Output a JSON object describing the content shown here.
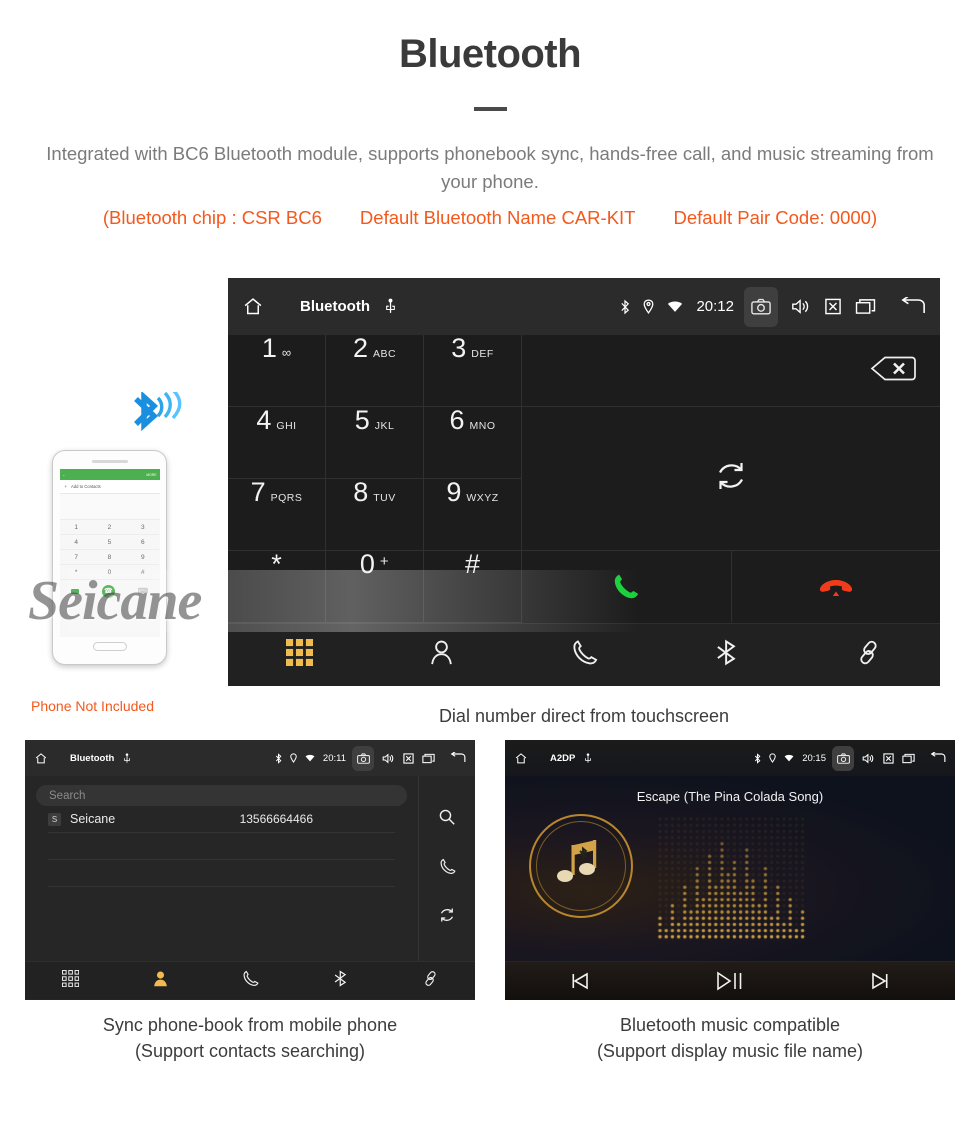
{
  "header": {
    "title": "Bluetooth",
    "description": "Integrated with BC6 Bluetooth module, supports phonebook sync, hands-free call, and music streaming from your phone.",
    "specs": [
      "(Bluetooth chip : CSR BC6",
      "Default Bluetooth Name CAR-KIT",
      "Default Pair Code: 0000)"
    ],
    "accent_color": "#f4581c",
    "text_color": "#7b7b7b"
  },
  "dialer": {
    "statusbar": {
      "title": "Bluetooth",
      "time": "20:12",
      "icons_left": [
        "home-icon",
        "usb-icon"
      ],
      "icons_right": [
        "bluetooth-icon",
        "location-icon",
        "wifi-icon",
        "camera-icon",
        "volume-icon",
        "close-icon",
        "recents-icon",
        "back-icon"
      ]
    },
    "keys": [
      {
        "num": "1",
        "sub": "∞",
        "sub_big": true
      },
      {
        "num": "2",
        "sub": "ABC",
        "sub_big": false
      },
      {
        "num": "3",
        "sub": "DEF",
        "sub_big": false
      },
      {
        "num": "4",
        "sub": "GHI",
        "sub_big": false
      },
      {
        "num": "5",
        "sub": "JKL",
        "sub_big": false
      },
      {
        "num": "6",
        "sub": "MNO",
        "sub_big": false
      },
      {
        "num": "7",
        "sub": "PQRS",
        "sub_big": false
      },
      {
        "num": "8",
        "sub": "TUV",
        "sub_big": false
      },
      {
        "num": "9",
        "sub": "WXYZ",
        "sub_big": false
      },
      {
        "num": "*",
        "sub": "",
        "sub_big": false
      },
      {
        "num": "0",
        "sub": "+",
        "sub_big": true
      },
      {
        "num": "#",
        "sub": "",
        "sub_big": false
      }
    ],
    "actions": {
      "backspace": "backspace-icon",
      "sync": "sync-icon",
      "call": "call-icon",
      "hangup": "hangup-icon"
    },
    "navbar": [
      {
        "name": "keypad",
        "icon": "keypad-icon",
        "active": true
      },
      {
        "name": "contacts",
        "icon": "contacts-icon",
        "active": false
      },
      {
        "name": "call-log",
        "icon": "phone-icon",
        "active": false
      },
      {
        "name": "bluetooth",
        "icon": "bluetooth-icon",
        "active": false
      },
      {
        "name": "pair",
        "icon": "link-icon",
        "active": false
      }
    ],
    "active_color": "#f0bc50",
    "call_color": "#17d13b",
    "hangup_color": "#f23b1a",
    "caption": "Dial number direct from touchscreen"
  },
  "phone_mock": {
    "app_bar_more": "MORE",
    "add_to_contacts": "Add to Contacts",
    "keys": [
      "1",
      "2",
      "3",
      "4",
      "5",
      "6",
      "7",
      "8",
      "9",
      "*",
      "0",
      "#"
    ],
    "label": "Phone Not Included",
    "bluetooth_icon": "bluetooth-broadcast-icon",
    "brand_watermark": "Seicane"
  },
  "phonebook": {
    "statusbar": {
      "title": "Bluetooth",
      "time": "20:11"
    },
    "search_placeholder": "Search",
    "contacts": [
      {
        "initial": "S",
        "name": "Seicane",
        "number": "13566664466"
      }
    ],
    "side_actions": [
      "search-icon",
      "phone-icon",
      "sync-icon"
    ],
    "navbar": [
      {
        "name": "keypad",
        "icon": "keypad-icon",
        "active": false
      },
      {
        "name": "contacts",
        "icon": "contacts-icon",
        "active": true
      },
      {
        "name": "call-log",
        "icon": "phone-icon",
        "active": false
      },
      {
        "name": "bluetooth",
        "icon": "bluetooth-icon",
        "active": false
      },
      {
        "name": "pair",
        "icon": "link-icon",
        "active": false
      }
    ],
    "caption_line1": "Sync phone-book from mobile phone",
    "caption_line2": "(Support contacts searching)"
  },
  "music": {
    "statusbar": {
      "title": "A2DP",
      "time": "20:15"
    },
    "song_title": "Escape (The Pina Colada Song)",
    "album_icon": "music-bluetooth-icon",
    "controls": [
      "previous-icon",
      "play-pause-icon",
      "next-icon"
    ],
    "caption_line1": "Bluetooth music compatible",
    "caption_line2": "(Support display music file name)",
    "gold_color": "#c99a3a"
  }
}
